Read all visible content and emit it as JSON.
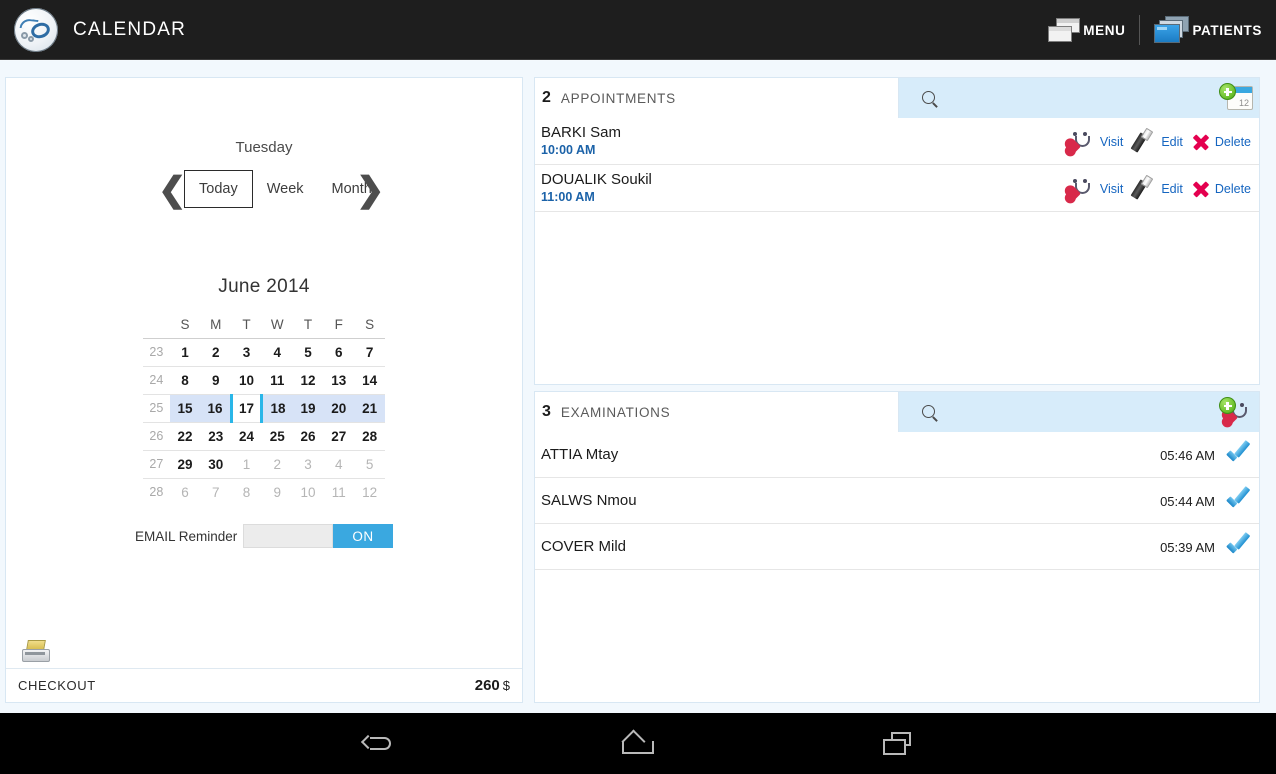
{
  "topbar": {
    "app_title": "CALENDAR",
    "logo_icon": "stethoscope-logo-icon",
    "menu_label": "MENU",
    "menu_icon": "windows-stack-icon",
    "patients_label": "PATIENTS",
    "patients_icon": "blue-folder-icon"
  },
  "calendar_panel": {
    "day_label": "Tuesday",
    "prev_icon": "chevron-left-icon",
    "next_icon": "chevron-right-icon",
    "views": [
      {
        "label": "Today",
        "active": true
      },
      {
        "label": "Week",
        "active": false
      },
      {
        "label": "Month",
        "active": false
      }
    ],
    "month_title": "June 2014",
    "weekday_headers": [
      "S",
      "M",
      "T",
      "W",
      "T",
      "F",
      "S"
    ],
    "weeks": [
      {
        "week_no": "23",
        "days": [
          {
            "d": "1",
            "out": false
          },
          {
            "d": "2",
            "out": false
          },
          {
            "d": "3",
            "out": false
          },
          {
            "d": "4",
            "out": false
          },
          {
            "d": "5",
            "out": false
          },
          {
            "d": "6",
            "out": false
          },
          {
            "d": "7",
            "out": false
          }
        ],
        "selected": false
      },
      {
        "week_no": "24",
        "days": [
          {
            "d": "8",
            "out": false
          },
          {
            "d": "9",
            "out": false
          },
          {
            "d": "10",
            "out": false
          },
          {
            "d": "11",
            "out": false
          },
          {
            "d": "12",
            "out": false
          },
          {
            "d": "13",
            "out": false
          },
          {
            "d": "14",
            "out": false
          }
        ],
        "selected": false
      },
      {
        "week_no": "25",
        "days": [
          {
            "d": "15",
            "out": false
          },
          {
            "d": "16",
            "out": false
          },
          {
            "d": "17",
            "out": false,
            "today": true
          },
          {
            "d": "18",
            "out": false
          },
          {
            "d": "19",
            "out": false
          },
          {
            "d": "20",
            "out": false
          },
          {
            "d": "21",
            "out": false
          }
        ],
        "selected": true
      },
      {
        "week_no": "26",
        "days": [
          {
            "d": "22",
            "out": false
          },
          {
            "d": "23",
            "out": false
          },
          {
            "d": "24",
            "out": false
          },
          {
            "d": "25",
            "out": false
          },
          {
            "d": "26",
            "out": false
          },
          {
            "d": "27",
            "out": false
          },
          {
            "d": "28",
            "out": false
          }
        ],
        "selected": false
      },
      {
        "week_no": "27",
        "days": [
          {
            "d": "29",
            "out": false
          },
          {
            "d": "30",
            "out": false
          },
          {
            "d": "1",
            "out": true
          },
          {
            "d": "2",
            "out": true
          },
          {
            "d": "3",
            "out": true
          },
          {
            "d": "4",
            "out": true
          },
          {
            "d": "5",
            "out": true
          }
        ],
        "selected": false
      },
      {
        "week_no": "28",
        "days": [
          {
            "d": "6",
            "out": true
          },
          {
            "d": "7",
            "out": true
          },
          {
            "d": "8",
            "out": true
          },
          {
            "d": "9",
            "out": true
          },
          {
            "d": "10",
            "out": true
          },
          {
            "d": "11",
            "out": true
          },
          {
            "d": "12",
            "out": true
          }
        ],
        "selected": false
      }
    ],
    "email_reminder_label": "EMAIL Reminder",
    "email_reminder_state": "ON",
    "register_icon": "cash-register-icon",
    "checkout_label": "CHECKOUT",
    "checkout_amount": "260",
    "checkout_currency": "$"
  },
  "appointments": {
    "count": "2",
    "title": "APPOINTMENTS",
    "search_icon": "search-icon",
    "add_icon": "add-appointment-calendar-icon",
    "action_labels": {
      "visit": "Visit",
      "edit": "Edit",
      "delete": "Delete"
    },
    "action_icons": {
      "visit": "stethoscope-icon",
      "edit": "pen-icon",
      "delete": "red-x-icon"
    },
    "rows": [
      {
        "name": "BARKI Sam",
        "time": "10:00 AM"
      },
      {
        "name": "DOUALIK Soukil",
        "time": "11:00 AM"
      }
    ]
  },
  "examinations": {
    "count": "3",
    "title": "EXAMINATIONS",
    "search_icon": "search-icon",
    "add_icon": "add-examination-stethoscope-icon",
    "status_icon": "blue-check-icon",
    "rows": [
      {
        "name": "ATTIA Mtay",
        "time": "05:46 AM"
      },
      {
        "name": "SALWS Nmou",
        "time": "05:44 AM"
      },
      {
        "name": "COVER Mild",
        "time": "05:39 AM"
      }
    ]
  },
  "system_navbar": {
    "back_icon": "back-arrow-icon",
    "home_icon": "home-icon",
    "recents_icon": "recents-icon"
  },
  "colors": {
    "accent_blue": "#3aa8e0",
    "header_blue": "#d7ecfa",
    "selected_week": "#d7e3f7",
    "today_border": "#29b6e8",
    "link_blue": "#1565c0",
    "delete_red": "#e4004f",
    "add_green": "#6cc02c",
    "topbar_dark": "#1e1e1e"
  }
}
